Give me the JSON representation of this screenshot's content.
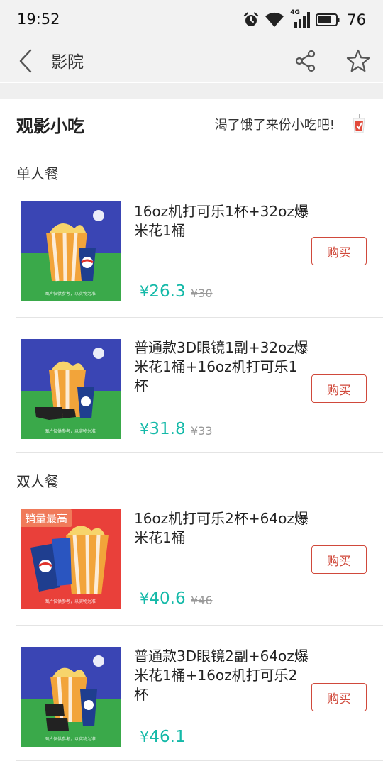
{
  "status_bar": {
    "time": "19:52",
    "network": "4G",
    "battery": "76",
    "icons": [
      "alarm-icon",
      "wifi-icon",
      "signal-icon",
      "battery-icon"
    ]
  },
  "nav": {
    "title": "影院",
    "icons": [
      "back-icon",
      "share-icon",
      "star-icon"
    ]
  },
  "section": {
    "title": "观影小吃",
    "slogan": "渴了饿了来份小吃吧!"
  },
  "categories": [
    {
      "label": "单人餐",
      "items": [
        {
          "name": "16oz机打可乐1杯+32oz爆米花1桶",
          "price": "26.3",
          "original_price": "¥30",
          "buy_label": "购买"
        },
        {
          "name": "普通款3D眼镜1副+32oz爆米花1桶+16oz机打可乐1杯",
          "price": "31.8",
          "original_price": "¥33",
          "buy_label": "购买"
        }
      ]
    },
    {
      "label": "双人餐",
      "items": [
        {
          "name": "16oz机打可乐2杯+64oz爆米花1桶",
          "price": "40.6",
          "original_price": "¥46",
          "buy_label": "购买",
          "badge": "销量最高"
        },
        {
          "name": "普通款3D眼镜2副+64oz爆米花1桶+16oz机打可乐2杯",
          "price": "46.1",
          "buy_label": "购买"
        }
      ]
    }
  ],
  "currency_symbol": "¥",
  "image_caption": "图片仅供参考，以实物为准",
  "colors": {
    "price": "#14b9a8",
    "buy_button": "#d0493b",
    "badge": "#f07a5a"
  }
}
